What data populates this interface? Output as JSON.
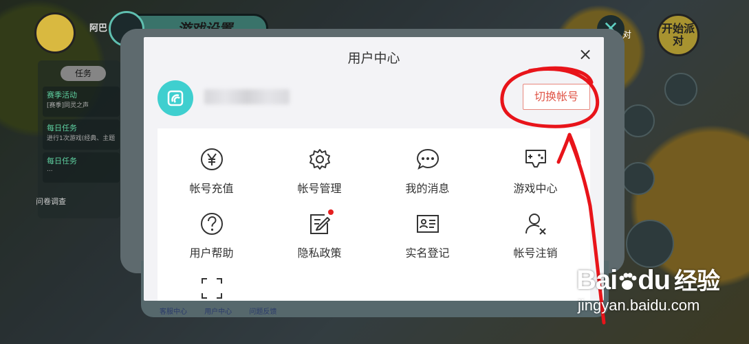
{
  "game": {
    "player_name": "阿巴",
    "settings_title": "游戏设置",
    "start_button": "开始派对",
    "right_label": "对",
    "panel_tab": "任务",
    "tasks": [
      {
        "title": "赛季活动",
        "desc": "[赛季]同灵之声"
      },
      {
        "title": "每日任务",
        "desc": "进行1次游戏(经典、主题"
      },
      {
        "title": "每日任务",
        "desc": "..."
      }
    ],
    "survey": "问卷调查",
    "bottom_tabs": [
      "客服中心",
      "用户中心",
      "问题反馈"
    ]
  },
  "dialog": {
    "title": "用户中心",
    "close_glyph": "×",
    "switch_account": "切换帐号",
    "menu": [
      {
        "label": "帐号充值",
        "icon": "yen-coin-icon"
      },
      {
        "label": "帐号管理",
        "icon": "gear-icon"
      },
      {
        "label": "我的消息",
        "icon": "chat-bubble-icon"
      },
      {
        "label": "游戏中心",
        "icon": "gamepad-icon"
      },
      {
        "label": "用户帮助",
        "icon": "question-icon"
      },
      {
        "label": "隐私政策",
        "icon": "document-edit-icon",
        "badge": true
      },
      {
        "label": "实名登记",
        "icon": "id-card-icon"
      },
      {
        "label": "帐号注销",
        "icon": "user-remove-icon"
      },
      {
        "label": "",
        "icon": "scan-icon"
      }
    ]
  },
  "watermark": {
    "brand": "Bai",
    "brand_suffix": "du",
    "brand_cn": "经验",
    "url": "jingyan.baidu.com"
  },
  "colors": {
    "accent_red": "#e05547",
    "avatar_teal": "#3fcfcf",
    "annotation_red": "#e8141a"
  }
}
